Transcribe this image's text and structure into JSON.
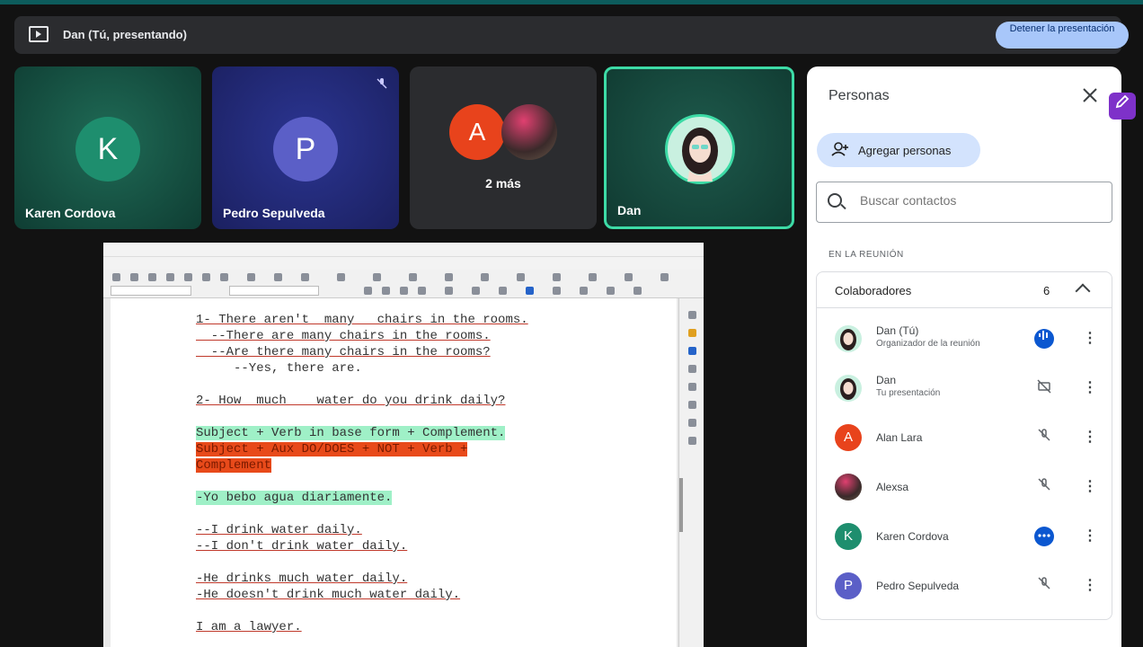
{
  "presenting_bar": {
    "text": "Dan (Tú, presentando)",
    "stop_button": "Detener la presentación"
  },
  "tiles": [
    {
      "name": "Karen Cordova",
      "initial": "K"
    },
    {
      "name": "Pedro Sepulveda",
      "initial": "P"
    },
    {
      "initial": "A",
      "more_label": "2 más"
    },
    {
      "name": "Dan"
    }
  ],
  "document": {
    "lines": [
      "1- There aren't  many   chairs in the rooms.",
      "  --There are many chairs in the rooms.",
      "  --Are there many chairs in the rooms?",
      "     --Yes, there are.",
      "2- How  much    water do you drink daily?",
      "Subject + Verb in base form + Complement.",
      "Subject + Aux DO/DOES + NOT + Verb +",
      "Complement",
      "-Yo bebo agua diariamente.",
      "--I drink water daily.",
      "--I don't drink water daily.",
      "-He drinks much water daily.",
      "-He doesn't drink much water daily.",
      "I am a lawyer."
    ]
  },
  "panel": {
    "title": "Personas",
    "add_button": "Agregar personas",
    "search_placeholder": "Buscar contactos",
    "section_label": "EN LA REUNIÓN",
    "group_label": "Colaboradores",
    "group_count": "6",
    "people": [
      {
        "name": "Dan (Tú)",
        "sub": "Organizador de la reunión",
        "initial": "",
        "color": "#c9f0e0",
        "status": "speaking"
      },
      {
        "name": "Dan",
        "sub": "Tu presentación",
        "initial": "",
        "color": "#c9f0e0",
        "status": "present-off"
      },
      {
        "name": "Alan Lara",
        "sub": "",
        "initial": "A",
        "color": "#e8431c",
        "status": "muted"
      },
      {
        "name": "Alexsa",
        "sub": "",
        "initial": "",
        "color": "#7a4a5a",
        "status": "muted"
      },
      {
        "name": "Karen Cordova",
        "sub": "",
        "initial": "K",
        "color": "#1e8e6e",
        "status": "dots"
      },
      {
        "name": "Pedro Sepulveda",
        "sub": "",
        "initial": "P",
        "color": "#5b5fc7",
        "status": "muted"
      }
    ]
  },
  "colors": {
    "accent": "#3ddba6",
    "button": "#a8c7fa"
  }
}
